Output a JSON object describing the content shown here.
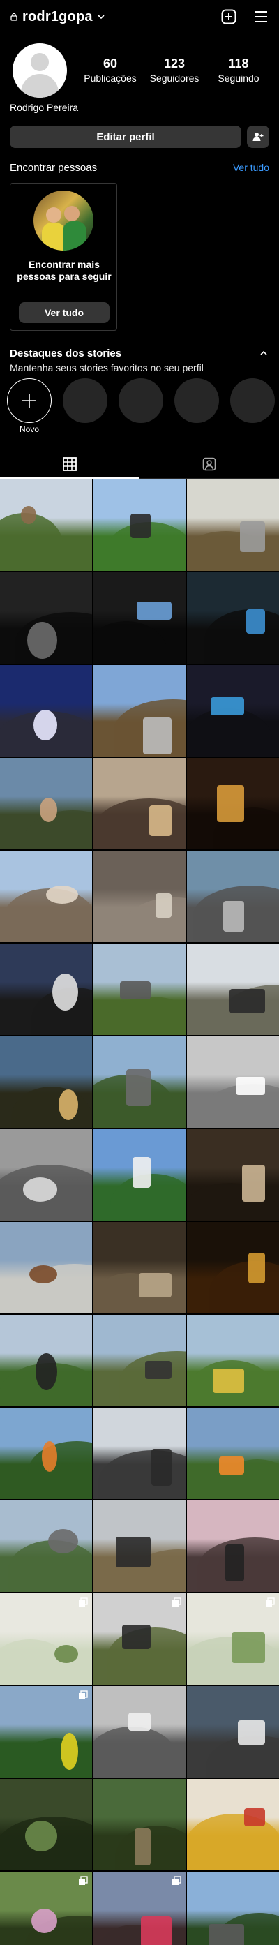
{
  "header": {
    "username": "rodr1gopa"
  },
  "profile": {
    "full_name": "Rodrigo Pereira",
    "stats": [
      {
        "value": "60",
        "label": "Publicações"
      },
      {
        "value": "123",
        "label": "Seguidores"
      },
      {
        "value": "118",
        "label": "Seguindo"
      }
    ]
  },
  "actions": {
    "edit_profile": "Editar perfil"
  },
  "discover": {
    "title": "Encontrar pessoas",
    "see_all": "Ver tudo",
    "card_message": "Encontrar mais pessoas para seguir",
    "card_button": "Ver tudo"
  },
  "highlights": {
    "title": "Destaques dos stories",
    "subtitle": "Mantenha seus stories favoritos no seu perfil",
    "new_label": "Novo"
  },
  "tabs": [
    {
      "icon": "grid-icon",
      "active": true
    },
    {
      "icon": "tagged-person-icon",
      "active": false
    }
  ],
  "posts": [
    {
      "sky": "#c9d4e0",
      "ground": "#4b6b2e",
      "accent": "#8a6a4a",
      "multi": false
    },
    {
      "sky": "#9ec1e6",
      "ground": "#3e7a2a",
      "accent": "#2a2a2a",
      "multi": false
    },
    {
      "sky": "#d7d7cf",
      "ground": "#6b5a3a",
      "accent": "#9b9b9b",
      "multi": false
    },
    {
      "sky": "#222222",
      "ground": "#0c0c0c",
      "accent": "#6c6c6c",
      "multi": false
    },
    {
      "sky": "#1a1a1a",
      "ground": "#090909",
      "accent": "#6aa0d8",
      "multi": false
    },
    {
      "sky": "#1c2a33",
      "ground": "#0d0d0d",
      "accent": "#3c8fd0",
      "multi": false
    },
    {
      "sky": "#1b2a6e",
      "ground": "#2a2a3a",
      "accent": "#e8e8ff",
      "multi": false
    },
    {
      "sky": "#7fa6d6",
      "ground": "#6a5434",
      "accent": "#bcbcbc",
      "multi": false
    },
    {
      "sky": "#1a1a2a",
      "ground": "#0f0f14",
      "accent": "#3a9ad9",
      "multi": false
    },
    {
      "sky": "#6b8aa8",
      "ground": "#3c4a2a",
      "accent": "#c9a27e",
      "multi": false
    },
    {
      "sky": "#b7a58e",
      "ground": "#4a3a2e",
      "accent": "#d8b98a",
      "multi": false
    },
    {
      "sky": "#2a1a10",
      "ground": "#130b06",
      "accent": "#d79a3a",
      "multi": false
    },
    {
      "sky": "#a9c3e0",
      "ground": "#7a6a58",
      "accent": "#e2d6c6",
      "multi": false
    },
    {
      "sky": "#6b6158",
      "ground": "#8f8478",
      "accent": "#d7cfc2",
      "multi": false
    },
    {
      "sky": "#6f8fa8",
      "ground": "#545454",
      "accent": "#b9b9b9",
      "multi": false
    },
    {
      "sky": "#2e3a58",
      "ground": "#1a1a1a",
      "accent": "#e0e0e0",
      "multi": false
    },
    {
      "sky": "#a9bfd4",
      "ground": "#4a6a2a",
      "accent": "#5a5a5a",
      "multi": false
    },
    {
      "sky": "#d8dde2",
      "ground": "#6a6a5a",
      "accent": "#2a2a2a",
      "multi": false
    },
    {
      "sky": "#4a6a8a",
      "ground": "#2a2a1a",
      "accent": "#d9b36a",
      "multi": false
    },
    {
      "sky": "#8fb0d0",
      "ground": "#3c5a2a",
      "accent": "#6a6a6a",
      "multi": false
    },
    {
      "sky": "#c7c7c7",
      "ground": "#7a7a7a",
      "accent": "#ffffff",
      "multi": false
    },
    {
      "sky": "#9a9a9a",
      "ground": "#5a5a5a",
      "accent": "#dcdcdc",
      "multi": false
    },
    {
      "sky": "#6a9ad4",
      "ground": "#2f6a2a",
      "accent": "#f1f1f1",
      "multi": false
    },
    {
      "sky": "#3a2e22",
      "ground": "#1e170f",
      "accent": "#cbb594",
      "multi": false
    },
    {
      "sky": "#8aa4c0",
      "ground": "#c9c9c4",
      "accent": "#7a4a2a",
      "multi": false
    },
    {
      "sky": "#3a3024",
      "ground": "#6a5a44",
      "accent": "#b8a588",
      "multi": false
    },
    {
      "sky": "#1a1108",
      "ground": "#3a1f07",
      "accent": "#d49a30",
      "multi": false
    },
    {
      "sky": "#b5c6d8",
      "ground": "#3f6a2a",
      "accent": "#222222",
      "multi": false
    },
    {
      "sky": "#9fb8d0",
      "ground": "#5a6a3a",
      "accent": "#333333",
      "multi": false
    },
    {
      "sky": "#a6c0d6",
      "ground": "#4c7a2e",
      "accent": "#e0c040",
      "multi": false
    },
    {
      "sky": "#7da6d0",
      "ground": "#2f5a22",
      "accent": "#e67d2a",
      "multi": false
    },
    {
      "sky": "#d0d6dc",
      "ground": "#3a3a3a",
      "accent": "#2a2a2a",
      "multi": false
    },
    {
      "sky": "#7a9ec6",
      "ground": "#3f6a2a",
      "accent": "#f08a2a",
      "multi": false
    },
    {
      "sky": "#a8bccf",
      "ground": "#4a6a3a",
      "accent": "#6a6a6a",
      "multi": false
    },
    {
      "sky": "#c0c4c8",
      "ground": "#7a6a4a",
      "accent": "#2a2a2a",
      "multi": false
    },
    {
      "sky": "#d6b6c0",
      "ground": "#4a3a3a",
      "accent": "#222222",
      "multi": false
    },
    {
      "sky": "#e8e8e0",
      "ground": "#cfd8c0",
      "accent": "#6a8a4a",
      "multi": true
    },
    {
      "sky": "#d0d0d0",
      "ground": "#5a6a3a",
      "accent": "#2a2a2a",
      "multi": true
    },
    {
      "sky": "#e6e6dc",
      "ground": "#c8d2b8",
      "accent": "#7a9a5a",
      "multi": true
    },
    {
      "sky": "#8aa8c8",
      "ground": "#2a5a22",
      "accent": "#e0d020",
      "multi": true
    },
    {
      "sky": "#bfbfbf",
      "ground": "#5a5a5a",
      "accent": "#efefef",
      "multi": false
    },
    {
      "sky": "#4a5a6a",
      "ground": "#3a3a3a",
      "accent": "#e8e8e8",
      "multi": false
    },
    {
      "sky": "#3a4a2a",
      "ground": "#1f2a14",
      "accent": "#6a8a4a",
      "multi": false
    },
    {
      "sky": "#4a6a3a",
      "ground": "#2a3a1a",
      "accent": "#8a7a5a",
      "multi": false
    },
    {
      "sky": "#e8e0d0",
      "ground": "#d8a828",
      "accent": "#c83a2a",
      "multi": false
    },
    {
      "sky": "#6a8a4a",
      "ground": "#2a3a1a",
      "accent": "#d8a0c8",
      "multi": true
    },
    {
      "sky": "#7a8aa8",
      "ground": "#3a2a2a",
      "accent": "#d83a5a",
      "multi": true
    },
    {
      "sky": "#8ab0d8",
      "ground": "#2a4a22",
      "accent": "#5a5a5a",
      "multi": false
    }
  ]
}
